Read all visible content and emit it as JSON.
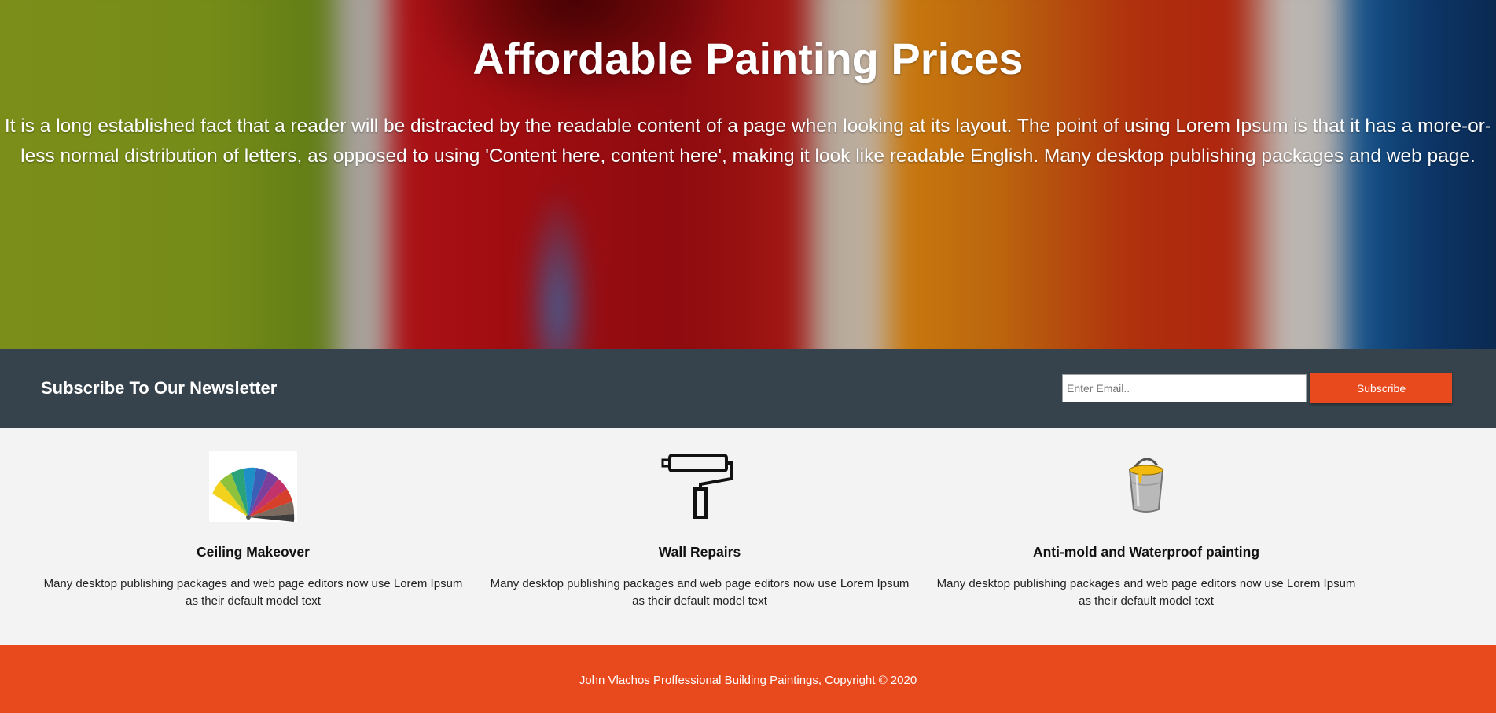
{
  "hero": {
    "title": "Affordable Painting Prices",
    "text": "It is a long established fact that a reader will be distracted by the readable content of a page when looking at its layout. The point of using Lorem Ipsum is that it has a more-or-less normal distribution of letters, as opposed to using 'Content here, content here', making it look like readable English. Many desktop publishing packages and web page."
  },
  "newsletter": {
    "title": "Subscribe To Our Newsletter",
    "email_placeholder": "Enter Email..",
    "email_value": "",
    "subscribe_label": "Subscribe"
  },
  "features": [
    {
      "icon": "color-swatch-fan-icon",
      "title": "Ceiling Makeover",
      "description": "Many desktop publishing packages and web page editors now use Lorem Ipsum as their default model text"
    },
    {
      "icon": "paint-roller-icon",
      "title": "Wall Repairs",
      "description": "Many desktop publishing packages and web page editors now use Lorem Ipsum as their default model text"
    },
    {
      "icon": "paint-bucket-icon",
      "title": "Anti-mold and Waterproof painting",
      "description": "Many desktop publishing packages and web page editors now use Lorem Ipsum as their default model text"
    }
  ],
  "footer": {
    "text": "John Vlachos Proffessional Building Paintings, Copyright © 2020"
  },
  "colors": {
    "accent": "#e84a1e",
    "newsletter_bg": "#36434c",
    "features_bg": "#f3f3f3"
  }
}
